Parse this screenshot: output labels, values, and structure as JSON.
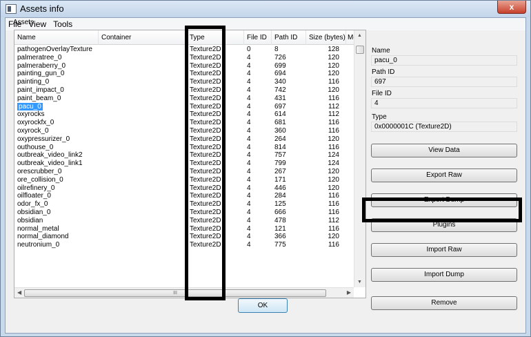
{
  "window": {
    "title": "Assets info",
    "close_symbol": "x"
  },
  "menu": [
    "File",
    "View",
    "Tools"
  ],
  "group_label": "Assets",
  "columns": [
    "Name",
    "Container",
    "Type",
    "File ID",
    "Path ID",
    "Size (bytes)",
    "Mo"
  ],
  "rows": [
    {
      "name": "pathogenOverlayTexture",
      "type": "Texture2D",
      "file_id": "0",
      "path_id": "8",
      "size": "128"
    },
    {
      "name": "palmeratree_0",
      "type": "Texture2D",
      "file_id": "4",
      "path_id": "726",
      "size": "120"
    },
    {
      "name": "palmeraberry_0",
      "type": "Texture2D",
      "file_id": "4",
      "path_id": "699",
      "size": "120"
    },
    {
      "name": "painting_gun_0",
      "type": "Texture2D",
      "file_id": "4",
      "path_id": "694",
      "size": "120"
    },
    {
      "name": "painting_0",
      "type": "Texture2D",
      "file_id": "4",
      "path_id": "340",
      "size": "116"
    },
    {
      "name": "paint_impact_0",
      "type": "Texture2D",
      "file_id": "4",
      "path_id": "742",
      "size": "120"
    },
    {
      "name": "paint_beam_0",
      "type": "Texture2D",
      "file_id": "4",
      "path_id": "431",
      "size": "116"
    },
    {
      "name": "pacu_0",
      "type": "Texture2D",
      "file_id": "4",
      "path_id": "697",
      "size": "112"
    },
    {
      "name": "oxyrocks",
      "type": "Texture2D",
      "file_id": "4",
      "path_id": "614",
      "size": "112"
    },
    {
      "name": "oxyrockfx_0",
      "type": "Texture2D",
      "file_id": "4",
      "path_id": "681",
      "size": "116"
    },
    {
      "name": "oxyrock_0",
      "type": "Texture2D",
      "file_id": "4",
      "path_id": "360",
      "size": "116"
    },
    {
      "name": "oxypressurizer_0",
      "type": "Texture2D",
      "file_id": "4",
      "path_id": "264",
      "size": "120"
    },
    {
      "name": "outhouse_0",
      "type": "Texture2D",
      "file_id": "4",
      "path_id": "814",
      "size": "116"
    },
    {
      "name": "outbreak_video_link2",
      "type": "Texture2D",
      "file_id": "4",
      "path_id": "757",
      "size": "124"
    },
    {
      "name": "outbreak_video_link1",
      "type": "Texture2D",
      "file_id": "4",
      "path_id": "799",
      "size": "124"
    },
    {
      "name": "orescrubber_0",
      "type": "Texture2D",
      "file_id": "4",
      "path_id": "267",
      "size": "120"
    },
    {
      "name": "ore_collision_0",
      "type": "Texture2D",
      "file_id": "4",
      "path_id": "171",
      "size": "120"
    },
    {
      "name": "oilrefinery_0",
      "type": "Texture2D",
      "file_id": "4",
      "path_id": "446",
      "size": "120"
    },
    {
      "name": "oilfloater_0",
      "type": "Texture2D",
      "file_id": "4",
      "path_id": "284",
      "size": "116"
    },
    {
      "name": "odor_fx_0",
      "type": "Texture2D",
      "file_id": "4",
      "path_id": "125",
      "size": "116"
    },
    {
      "name": "obsidian_0",
      "type": "Texture2D",
      "file_id": "4",
      "path_id": "666",
      "size": "116"
    },
    {
      "name": "obsidian",
      "type": "Texture2D",
      "file_id": "4",
      "path_id": "478",
      "size": "112"
    },
    {
      "name": "normal_metal",
      "type": "Texture2D",
      "file_id": "4",
      "path_id": "121",
      "size": "116"
    },
    {
      "name": "normal_diamond",
      "type": "Texture2D",
      "file_id": "4",
      "path_id": "366",
      "size": "120"
    },
    {
      "name": "neutronium_0",
      "type": "Texture2D",
      "file_id": "4",
      "path_id": "775",
      "size": "116"
    }
  ],
  "selected_index": 7,
  "hscroll_grip": "III",
  "details": {
    "name_label": "Name",
    "name_value": "pacu_0",
    "pathid_label": "Path ID",
    "pathid_value": "697",
    "fileid_label": "File ID",
    "fileid_value": "4",
    "type_label": "Type",
    "type_value": "0x0000001C (Texture2D)"
  },
  "buttons": {
    "view_data": "View Data",
    "export_raw": "Export Raw",
    "export_dump": "Export Dump",
    "plugins": "Plugins",
    "import_raw": "Import Raw",
    "import_dump": "Import Dump",
    "remove": "Remove",
    "ok": "OK"
  },
  "colors": {
    "selection": "#3399ff",
    "highlight_frame": "#000000"
  }
}
